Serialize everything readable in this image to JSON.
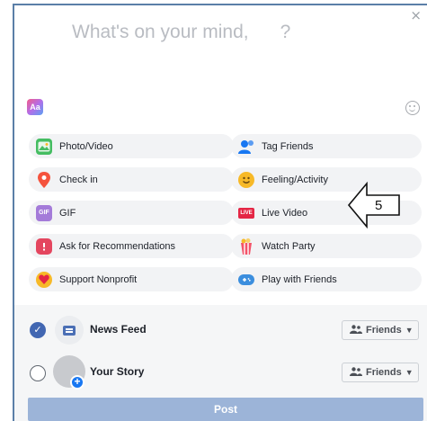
{
  "composer": {
    "placeholder": "What's on your mind,      ?",
    "close_glyph": "×",
    "font_button_text": "Aa"
  },
  "options": [
    {
      "label": "Photo/Video",
      "icon": "photo-icon",
      "color": "#45bd62"
    },
    {
      "label": "Tag Friends",
      "icon": "tag-friends-icon",
      "color": "#1877f2"
    },
    {
      "label": "Check in",
      "icon": "location-pin-icon",
      "color": "#f5533d"
    },
    {
      "label": "Feeling/Activity",
      "icon": "smiley-icon",
      "color": "#f7b928"
    },
    {
      "label": "GIF",
      "icon": "gif-icon",
      "color": "#a47bd9"
    },
    {
      "label": "Live Video",
      "icon": "live-icon",
      "color": "#e42645"
    },
    {
      "label": "Ask for Recommendations",
      "icon": "recommendation-icon",
      "color": "#e4465f"
    },
    {
      "label": "Watch Party",
      "icon": "watch-party-icon",
      "color": "#f35369"
    },
    {
      "label": "Support Nonprofit",
      "icon": "heart-icon",
      "color": "#f5533d"
    },
    {
      "label": "Play with Friends",
      "icon": "game-controller-icon",
      "color": "#3b8ede"
    }
  ],
  "audience": {
    "news_feed": {
      "label": "News Feed",
      "checked": true,
      "privacy": "Friends"
    },
    "your_story": {
      "label": "Your Story",
      "checked": false,
      "privacy": "Friends"
    }
  },
  "post_button": "Post",
  "annotation": {
    "number": "5"
  },
  "colors": {
    "accent": "#4267b2",
    "post_disabled": "#9cb4d8",
    "pill_bg": "#f2f3f5",
    "bottom_bg": "#f5f6f7"
  }
}
